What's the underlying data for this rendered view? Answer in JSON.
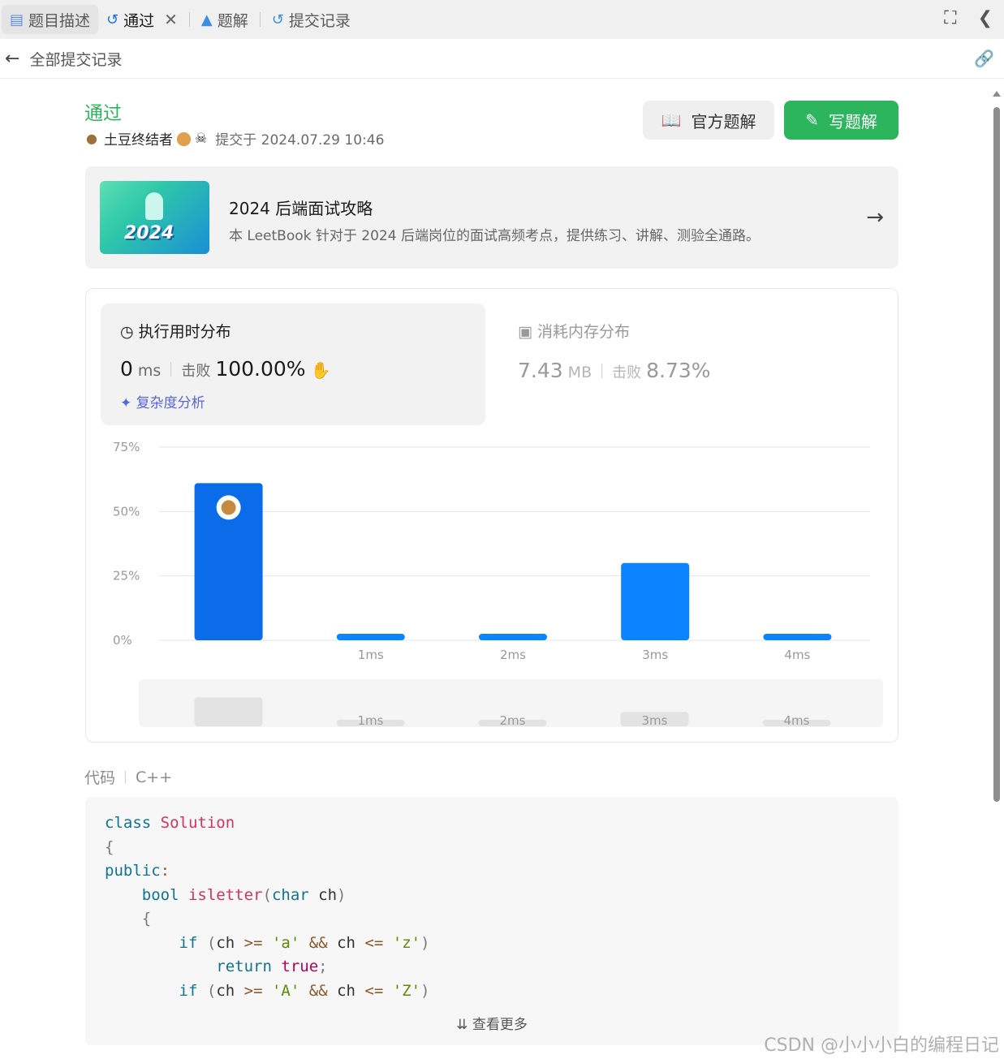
{
  "tabs": [
    {
      "label": "题目描述",
      "icon": "document-icon"
    },
    {
      "label": "通过",
      "icon": "history-icon",
      "active": true
    },
    {
      "label": "题解",
      "icon": "flask-icon"
    },
    {
      "label": "提交记录",
      "icon": "history-icon"
    }
  ],
  "subbar": {
    "label": "全部提交记录"
  },
  "submission": {
    "status": "通过",
    "user": "土豆终结者",
    "submitted": "提交于 2024.07.29 10:46"
  },
  "buttons": {
    "official": "官方题解",
    "write": "写题解"
  },
  "banner": {
    "title": "2024 后端面试攻略",
    "subtitle": "本 LeetBook 针对于 2024 后端岗位的面试高频考点，提供练习、讲解、测验全通路。",
    "image_text": "2024"
  },
  "runtime": {
    "heading": "执行用时分布",
    "value": "0",
    "unit": "ms",
    "beat_label": "击败",
    "beat": "100.00%",
    "analysis": "复杂度分析"
  },
  "memory": {
    "heading": "消耗内存分布",
    "value": "7.43",
    "unit": "MB",
    "beat_label": "击败",
    "beat": "8.73%"
  },
  "chart_data": {
    "type": "bar",
    "categories": [
      "",
      "1ms",
      "2ms",
      "3ms",
      "4ms"
    ],
    "values": [
      61,
      2,
      2,
      30,
      2
    ],
    "yticks": [
      "75%",
      "50%",
      "25%",
      "0%"
    ],
    "ylim": [
      0,
      75
    ],
    "highlight_index": 0,
    "colors": {
      "highlight": "#0a6ce8",
      "bar": "#0a84ff"
    }
  },
  "code": {
    "label": "代码",
    "language": "C++",
    "more": "查看更多"
  },
  "watermark": "CSDN @小小小白的编程日记"
}
